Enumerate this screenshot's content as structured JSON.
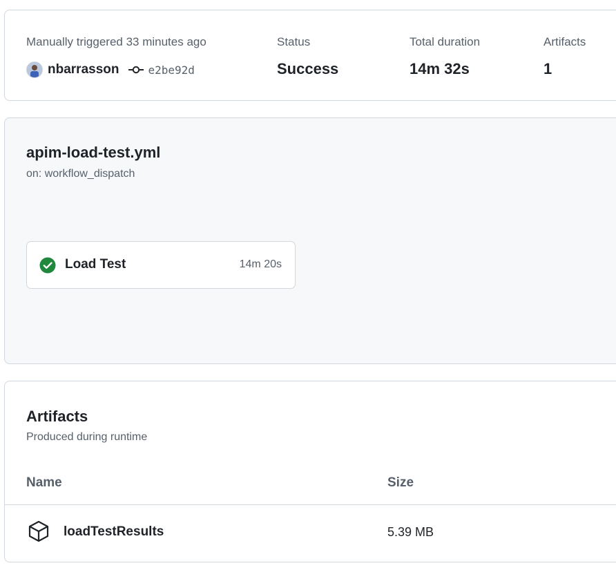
{
  "summary": {
    "trigger_text": "Manually triggered 33 minutes ago",
    "actor": "nbarrasson",
    "commit_sha": "e2be92d",
    "status_label": "Status",
    "status_value": "Success",
    "duration_label": "Total duration",
    "duration_value": "14m 32s",
    "artifacts_label": "Artifacts",
    "artifacts_value": "1"
  },
  "workflow": {
    "file": "apim-load-test.yml",
    "trigger": "on: workflow_dispatch",
    "jobs": [
      {
        "name": "Load Test",
        "duration": "14m 20s",
        "status": "success"
      }
    ]
  },
  "artifacts": {
    "title": "Artifacts",
    "subtitle": "Produced during runtime",
    "columns": {
      "name": "Name",
      "size": "Size"
    },
    "rows": [
      {
        "name": "loadTestResults",
        "size": "5.39 MB"
      }
    ]
  },
  "colors": {
    "success": "#1f883d",
    "border": "#d0d7de",
    "muted_text": "#57606a",
    "panel_bg": "#f6f8fa"
  },
  "icons": {
    "commit": "git-commit-icon",
    "check": "check-circle-fill-icon",
    "package": "package-icon"
  }
}
